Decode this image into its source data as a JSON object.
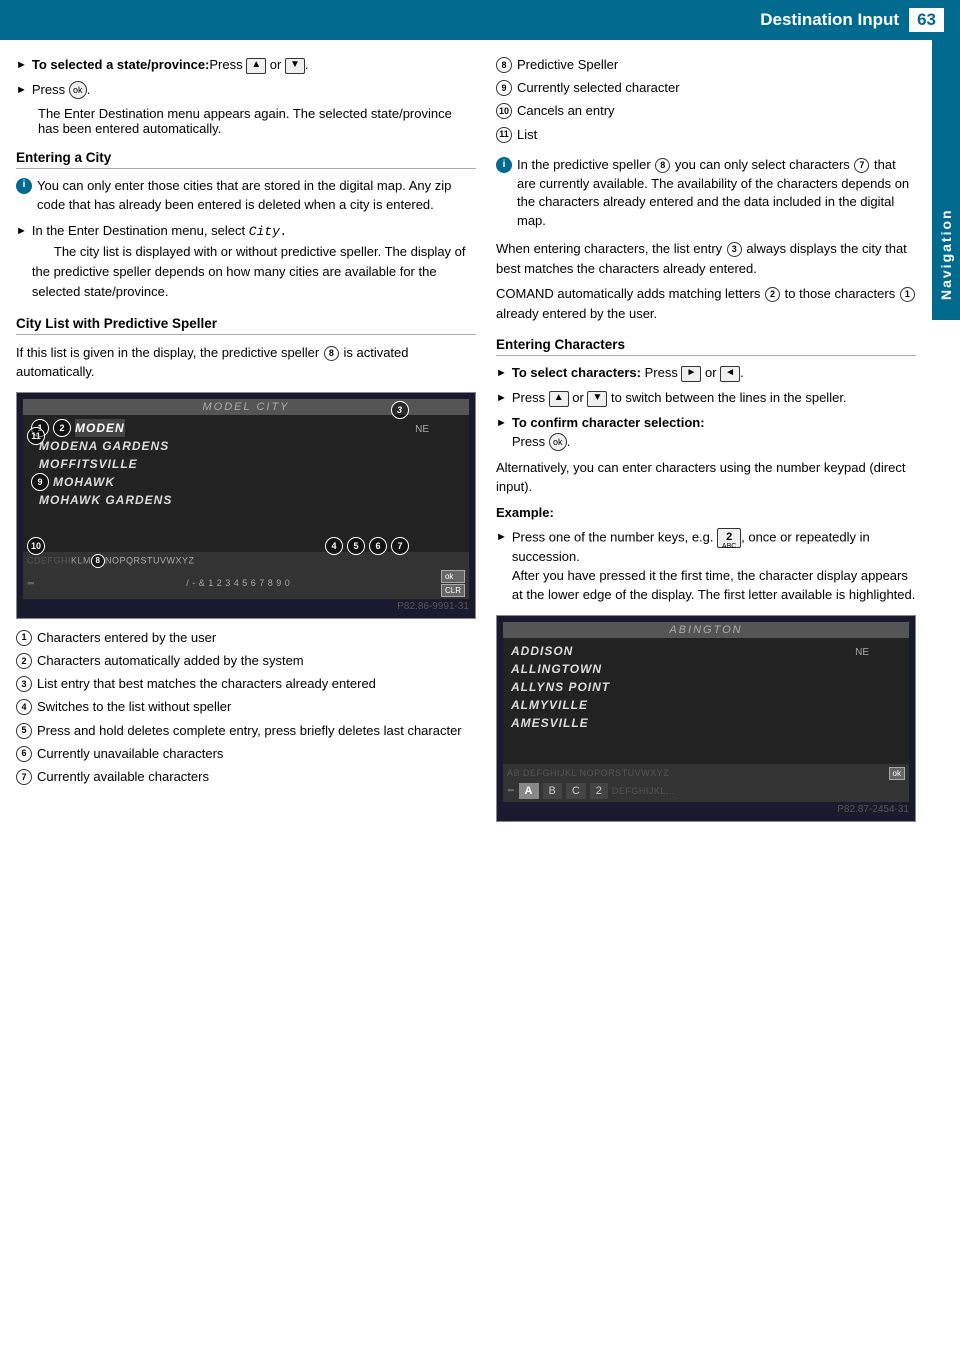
{
  "header": {
    "title": "Destination Input",
    "page_number": "63",
    "side_tab": "Navigation"
  },
  "left_column": {
    "state_province_section": {
      "bullet1": {
        "label": "To selected a state/province:",
        "text1": "Press",
        "key_up": "▲",
        "or": "or",
        "key_down": "▼"
      },
      "bullet2": {
        "text": "Press",
        "key_ok": "ok"
      },
      "description": "The Enter Destination menu appears again. The selected state/province has been entered automatically."
    },
    "entering_city": {
      "heading": "Entering a City",
      "info_text": "You can only enter those cities that are stored in the digital map. Any zip code that has already been entered is deleted when a city is entered.",
      "bullet1": {
        "text": "In the Enter Destination menu, select",
        "code": "City.",
        "desc": "The city list is displayed with or without predictive speller. The display of the predictive speller depends on how many cities are available for the selected state/province."
      }
    },
    "city_list_speller": {
      "heading": "City List with Predictive Speller",
      "text": "If this list is given in the display, the predictive speller",
      "num": "8",
      "text2": "is activated automatically."
    },
    "screenshot1": {
      "caption": "P82.86-9991-31",
      "header_text": "MODEL CITY",
      "list_items": [
        "MODEN",
        "MODENA GARDENS",
        "MOFFITSVILLE",
        "MOHAWK",
        "MOHAWK GARDENS"
      ],
      "ne_label": "NE",
      "keyboard_row1": "CDEFGHIKLMNOPORSTUVWXYZ",
      "keyboard_row2": "/ - & 1 2 3 4 5 6 7 8 9 0",
      "ok_label": "ok",
      "clr_label": "CLR",
      "badges": [
        "1",
        "2",
        "3",
        "4",
        "5",
        "6",
        "7",
        "8",
        "9",
        "10",
        "11"
      ]
    },
    "legend": [
      {
        "num": "1",
        "text": "Characters entered by the user"
      },
      {
        "num": "2",
        "text": "Characters automatically added by the system"
      },
      {
        "num": "3",
        "text": "List entry that best matches the characters already entered"
      },
      {
        "num": "4",
        "text": "Switches to the list without speller"
      },
      {
        "num": "5",
        "text": "Press and hold deletes complete entry, press briefly deletes last character"
      },
      {
        "num": "6",
        "text": "Currently unavailable characters"
      },
      {
        "num": "7",
        "text": "Currently available characters"
      }
    ]
  },
  "right_column": {
    "numbered_items": [
      {
        "num": "8",
        "text": "Predictive Speller"
      },
      {
        "num": "9",
        "text": "Currently selected character"
      },
      {
        "num": "10",
        "text": "Cancels an entry"
      },
      {
        "num": "11",
        "text": "List"
      }
    ],
    "info_block": {
      "text": "In the predictive speller",
      "num8": "8",
      "text2": "you can only select characters",
      "num7": "7",
      "text3": "that are currently available. The availability of the characters depends on the characters already entered and the data included in the digital map."
    },
    "para1": "When entering characters, the list entry",
    "num3_inline": "3",
    "para1b": "always displays the city that best matches the characters already entered.",
    "para2": "COMAND automatically adds matching letters",
    "num2_inline": "2",
    "para2b": "to those characters",
    "num1_inline": "1",
    "para2c": "already entered by the user.",
    "entering_characters": {
      "heading": "Entering Characters",
      "bullet1": {
        "label": "To select characters:",
        "text": "Press",
        "key_right": "►",
        "or": "or",
        "key_left": "◄"
      },
      "bullet2": {
        "text": "Press",
        "key_up": "▲",
        "or": "or",
        "key_down": "▼",
        "desc": "to switch between the lines in the speller."
      },
      "bullet3": {
        "label": "To confirm character selection:",
        "text": "Press",
        "key_ok": "ok"
      },
      "alt_text": "Alternatively, you can enter characters using the number keypad (direct input).",
      "example_label": "Example:",
      "example_bullet": {
        "text": "Press one of the number keys, e.g.",
        "key": "2",
        "key_sub": "ABC",
        "desc": ", once or repeatedly in succession. After you have pressed it the first time, the character display appears at the lower edge of the display. The first letter available is highlighted."
      }
    },
    "screenshot2": {
      "caption": "P82.87-2454-31",
      "header_text": "ABINGTON",
      "list_items": [
        "ADDISON",
        "ALLINGTOWN",
        "ALLYNS POINT",
        "ALMYVILLE",
        "AMESVILLE"
      ],
      "ne_label": "NE",
      "keyboard_row1": "AB DEFGHIJKL  NOPORSTUVWXYZ",
      "keyboard_highlight": "A  B  C  2",
      "ok_label": "ok"
    }
  }
}
